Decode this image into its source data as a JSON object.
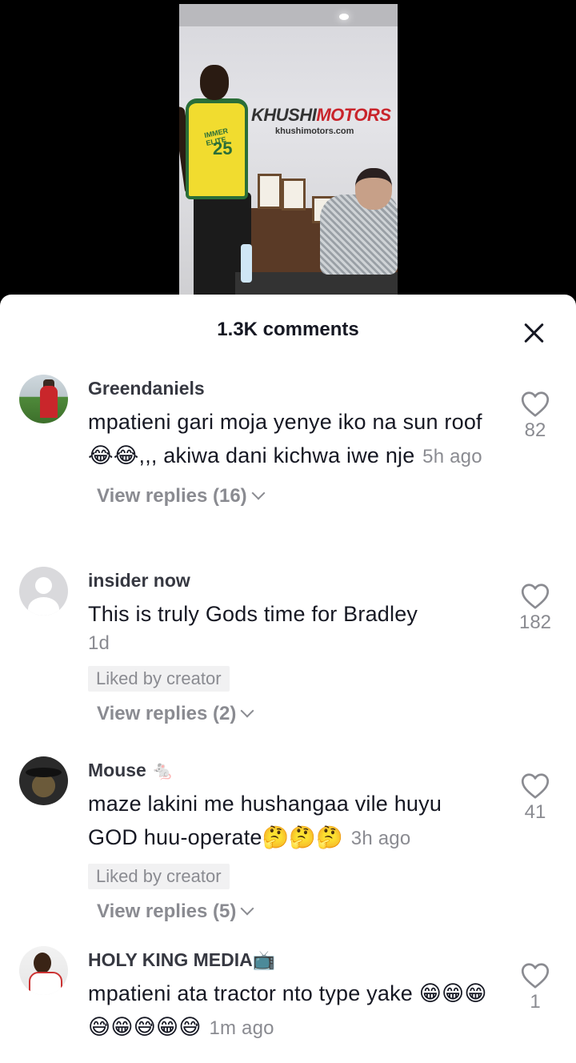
{
  "video": {
    "sign_brand_a": "KHUSHI",
    "sign_brand_b": "MOTORS",
    "sign_url": "khushimotors.com",
    "jersey_text": "IMMER ELITE",
    "jersey_number": "25"
  },
  "comments_sheet": {
    "title": "1.3K comments",
    "close_icon": "close-icon",
    "comments": [
      {
        "username": "Greendaniels",
        "text": "mpatieni gari moja yenye iko na sun roof😂😂,,, akiwa dani kichwa iwe nje",
        "time": "5h ago",
        "likes": "82",
        "replies": "View replies (16)"
      },
      {
        "username": "insider now",
        "text": "This is truly Gods time for Bradley",
        "time": "1d",
        "liked_by_creator": "Liked by creator",
        "likes": "182",
        "replies": "View replies (2)"
      },
      {
        "username": "Mouse 🐁",
        "text": "maze lakini me hushangaa vile huyu GOD huu-operate🤔🤔🤔",
        "time": "3h ago",
        "liked_by_creator": "Liked by creator",
        "likes": "41",
        "replies": "View replies (5)"
      },
      {
        "username": "HOLY KING MEDIA📺",
        "text": "mpatieni ata tractor nto type yake 😁😁😁😅😁😅😁😅",
        "time": "1m ago",
        "likes": "1"
      }
    ]
  }
}
